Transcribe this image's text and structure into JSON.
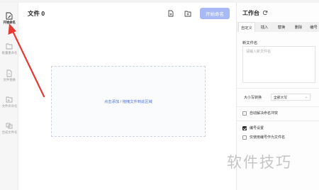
{
  "sidebar": {
    "items": [
      {
        "label": "开始命名",
        "icon": "file-edit-icon",
        "active": true
      },
      {
        "label": "批量重命名",
        "icon": "folder-edit-icon",
        "active": false
      },
      {
        "label": "文件替换",
        "icon": "file-replace-icon",
        "active": false
      },
      {
        "label": "文件夹命名",
        "icon": "folder-icon",
        "active": false
      },
      {
        "label": "合成文件名",
        "icon": "merge-icon",
        "active": false
      }
    ]
  },
  "main": {
    "title": "文件 0",
    "start_button": "开始命名",
    "dropzone_text": "点击添加 / 拖拽文件到此区域"
  },
  "panel": {
    "title": "工作台",
    "tabs": [
      "自定义",
      "插入",
      "替换",
      "删除",
      "编号"
    ],
    "active_tab": "自定义",
    "new_name_label": "新文件名",
    "new_name_placeholder": "请输入新文件名",
    "case_label": "大小写转换",
    "case_value": "全部大写",
    "options": [
      {
        "label": "自动解决命名冲突",
        "checked": false
      },
      {
        "label": "编号设置",
        "checked": true
      },
      {
        "label": "仅使用编号作为文件名",
        "checked": false
      }
    ]
  },
  "watermark": "软件技巧",
  "colors": {
    "accent_button": "#a9b9f6",
    "link_text": "#4b6fd8",
    "annotation_arrow": "#e53935"
  }
}
